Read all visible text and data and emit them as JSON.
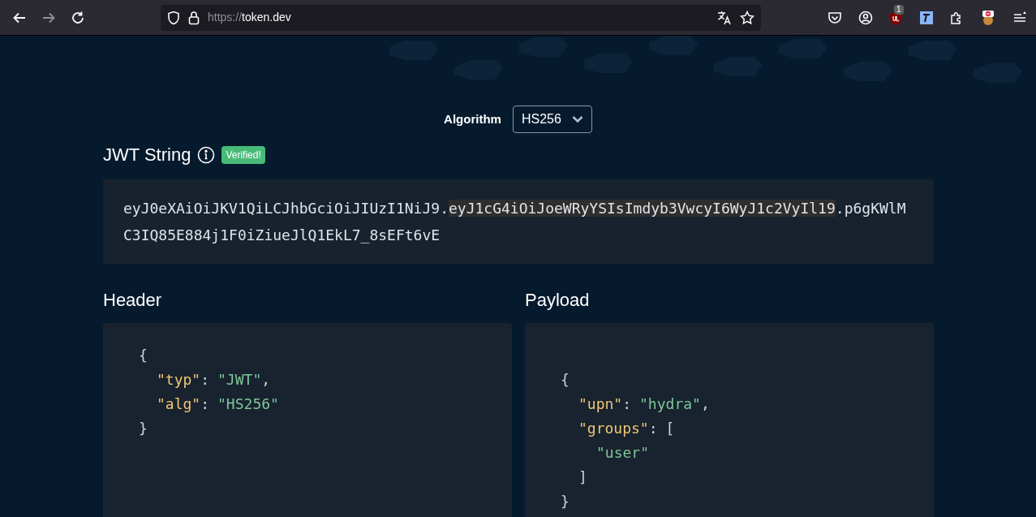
{
  "browser": {
    "url_scheme": "https://",
    "url_host": "token.dev",
    "extension_badge": "1"
  },
  "algorithm": {
    "label": "Algorithm",
    "value": "HS256"
  },
  "jwt": {
    "title": "JWT String",
    "badge": "Verified!",
    "segments": [
      {
        "text": "eyJ0eXAiOiJKV1QiLCJhbGciOiJIUzI1NiJ9.",
        "highlighted": false
      },
      {
        "text": "eyJ1cG4iOiJoeWRyYSIsImdyb3VwcyI6WyJ1c2VyIl19",
        "highlighted": true
      },
      {
        "text": ".p6gKWlMC3IQ85E884j1F0iZiueJlQ1EkL7_8sEFt6vE",
        "highlighted": false
      }
    ]
  },
  "panels": [
    {
      "title": "Header",
      "json": {
        "open": "{",
        "close": "}",
        "children": [
          {
            "key": "\"typ\"",
            "sep": ":",
            "value": "\"JWT\"",
            "comma": ","
          },
          {
            "key": "\"alg\"",
            "sep": ":",
            "value": "\"HS256\""
          }
        ]
      }
    },
    {
      "title": "Payload",
      "json": {
        "open": "{",
        "close": "}",
        "children": [
          {
            "key": "\"upn\"",
            "sep": ":",
            "value": "\"hydra\"",
            "comma": ","
          },
          {
            "key": "\"groups\"",
            "sep": ":",
            "open": "[",
            "close": "]",
            "children": [
              {
                "value": "\"user\""
              }
            ]
          }
        ]
      }
    }
  ]
}
